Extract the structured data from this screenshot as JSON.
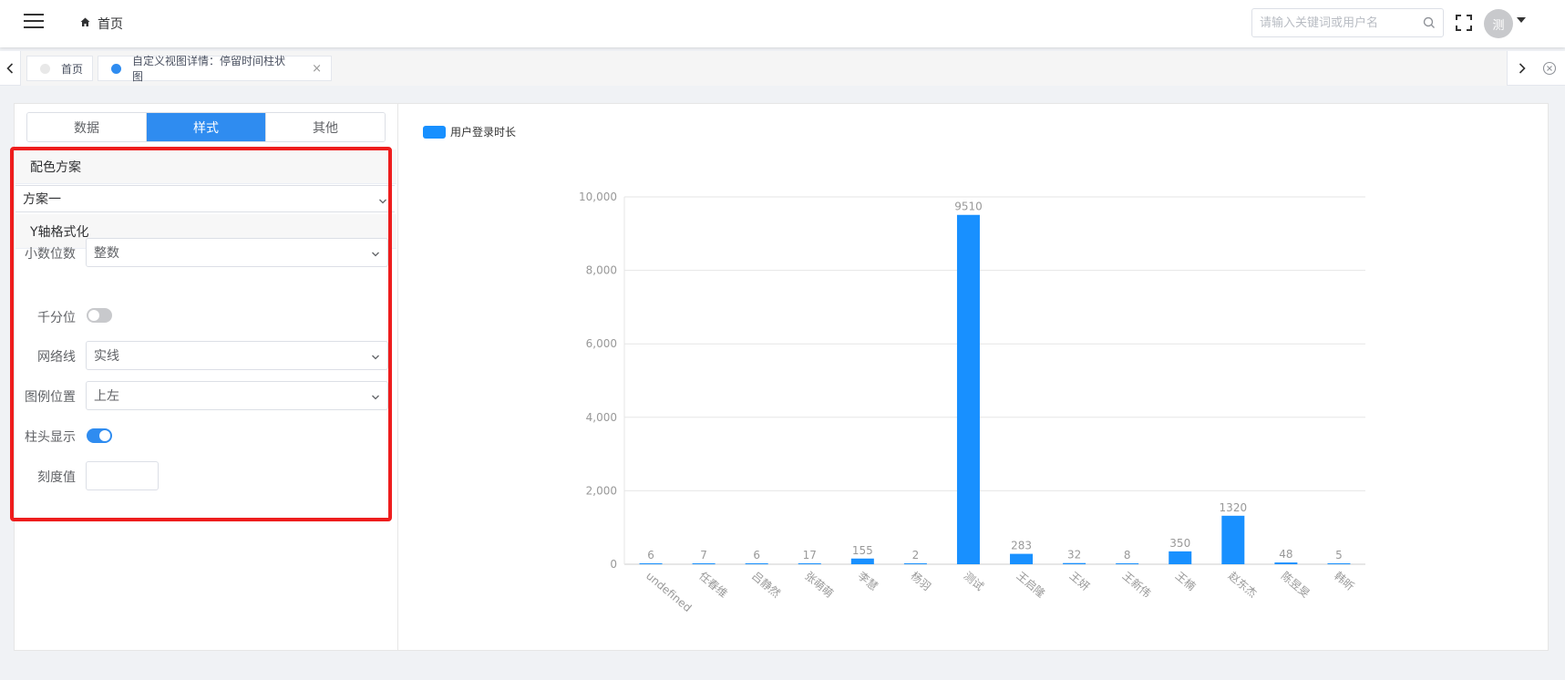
{
  "navbar": {
    "breadcrumb_home": "首页",
    "search_placeholder": "请输入关键词或用户名",
    "avatar_text": "测"
  },
  "tagsbar": {
    "tags": [
      {
        "label": "首页",
        "active": false
      },
      {
        "label": "自定义视图详情：停留时间柱状图",
        "active": true,
        "close": "×"
      }
    ]
  },
  "left_panel": {
    "tabs": [
      {
        "label": "数据",
        "active": false
      },
      {
        "label": "样式",
        "active": true
      },
      {
        "label": "其他",
        "active": false
      }
    ],
    "color_scheme": {
      "header": "配色方案",
      "value": "方案一"
    },
    "y_axis_format": {
      "header": "Y轴格式化",
      "decimal_label": "小数位数",
      "decimal_value": "整数",
      "thousands_label": "千分位",
      "thousands_on": false,
      "gridline_label": "网络线",
      "gridline_value": "实线",
      "legend_pos_label": "图例位置",
      "legend_pos_value": "上左",
      "bar_label_label": "柱头显示",
      "bar_label_on": true,
      "scale_label": "刻度值",
      "scale_value": ""
    }
  },
  "colors": {
    "primary": "#2f8cf0",
    "bar": "#1890ff",
    "highlight": "#ee1d1d"
  },
  "chart_data": {
    "type": "bar",
    "categories": [
      "undefined",
      "任春维",
      "吕静然",
      "张萌萌",
      "李慧",
      "杨羽",
      "测试",
      "王启隆",
      "王妍",
      "王新伟",
      "王楠",
      "赵东杰",
      "陈昱旻",
      "韩昕"
    ],
    "series": [
      {
        "name": "用户登录时长",
        "values": [
          6,
          7,
          6,
          17,
          155,
          2,
          9510,
          283,
          32,
          8,
          350,
          1320,
          48,
          5
        ]
      }
    ],
    "ylim": [
      0,
      10000
    ],
    "yticks": [
      "0",
      "2,000",
      "4,000",
      "6,000",
      "8,000",
      "10,000"
    ],
    "grid": true,
    "legend": "top-left",
    "data_labels": true
  }
}
